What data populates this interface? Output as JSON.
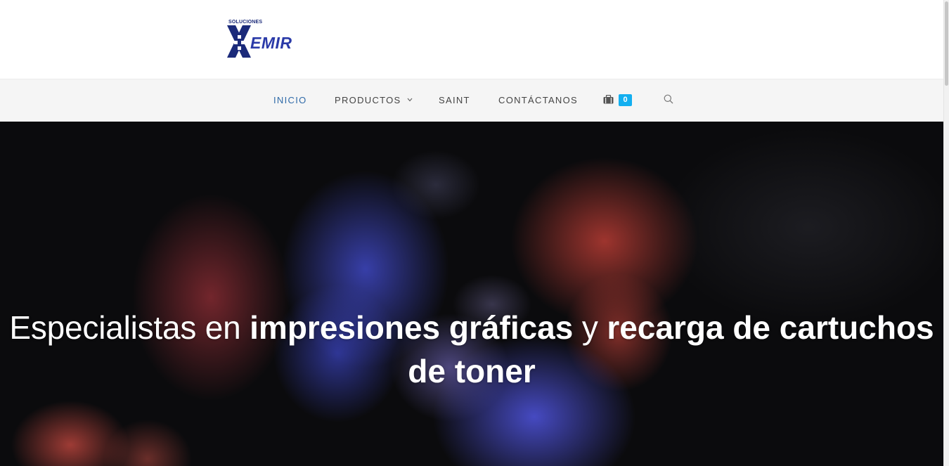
{
  "logo": {
    "small_text": "SOLUCIONES",
    "brand_text": "EMIR",
    "brand_color": "#2a3aa8"
  },
  "nav": {
    "items": [
      {
        "label": "INICIO",
        "active": true
      },
      {
        "label": "PRODUCTOS",
        "has_dropdown": true
      },
      {
        "label": "SAINT"
      },
      {
        "label": "CONTÁCTANOS"
      }
    ],
    "cart_count": "0",
    "cart_icon": "shopping-bag-icon",
    "search_icon": "search-icon",
    "active_color": "#2f6aa8",
    "badge_color": "#13aff0"
  },
  "hero": {
    "title_part1": "Especialistas en ",
    "title_bold1": "impresiones gráficas",
    "title_part2": " y ",
    "title_bold2": "recarga de cartuchos de toner"
  }
}
